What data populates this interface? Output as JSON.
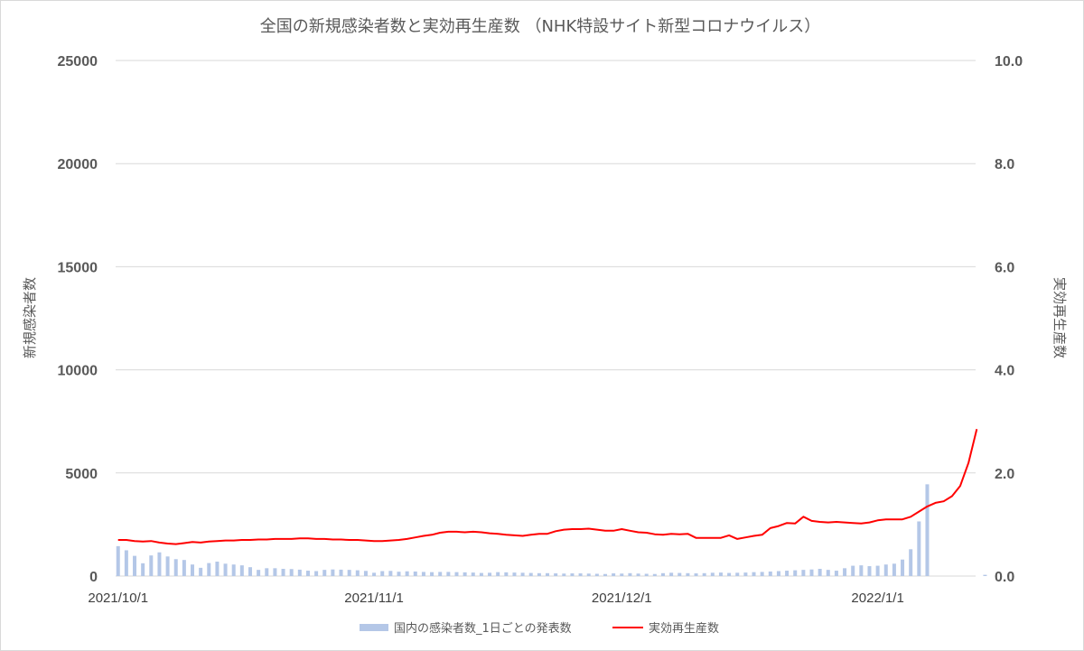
{
  "chart_data": {
    "type": "bar+line",
    "title": "全国の新規感染者数と実効再生産数 （NHK特設サイト新型コロナウイルス）",
    "ylabel_left": "新規感染者数",
    "ylabel_right": "実効再生産数",
    "ylim_left": [
      0,
      25000
    ],
    "ylim_right": [
      0.0,
      10.0
    ],
    "yticks_left": [
      "0",
      "5000",
      "10000",
      "15000",
      "20000",
      "25000"
    ],
    "yticks_right": [
      "0.0",
      "2.0",
      "4.0",
      "6.0",
      "8.0",
      "10.0"
    ],
    "xticks": [
      "2021/10/1",
      "2021/11/1",
      "2021/12/1",
      "2022/1/1"
    ],
    "grid": true,
    "legend_position": "bottom",
    "colors": {
      "bars": "#b4c7e7",
      "line": "#ff0000",
      "grid": "#d9d9d9"
    },
    "x_start": "2021/10/1",
    "x_end": "2022/1/16",
    "series": [
      {
        "name": "国内の感染者数_1日ごとの発表数",
        "kind": "bar",
        "axis": "left",
        "values": [
          1450,
          1250,
          980,
          620,
          1000,
          1150,
          950,
          820,
          780,
          560,
          400,
          630,
          700,
          600,
          560,
          520,
          430,
          300,
          380,
          380,
          350,
          340,
          310,
          260,
          240,
          300,
          320,
          310,
          300,
          280,
          250,
          160,
          240,
          250,
          210,
          230,
          220,
          200,
          190,
          200,
          200,
          190,
          180,
          170,
          150,
          160,
          190,
          180,
          170,
          160,
          150,
          140,
          140,
          130,
          120,
          130,
          130,
          120,
          110,
          100,
          130,
          120,
          140,
          120,
          110,
          100,
          140,
          160,
          150,
          140,
          130,
          140,
          160,
          170,
          150,
          160,
          170,
          190,
          200,
          220,
          240,
          260,
          280,
          300,
          320,
          350,
          300,
          260,
          380,
          500,
          520,
          480,
          500,
          560,
          600,
          800,
          1300,
          2650,
          4450,
          0,
          0,
          0,
          0,
          0,
          0,
          60,
          0
        ]
      },
      {
        "name": "実効再生産数",
        "kind": "line",
        "axis": "right",
        "values": [
          0.7,
          0.7,
          0.68,
          0.67,
          0.68,
          0.65,
          0.63,
          0.62,
          0.64,
          0.66,
          0.65,
          0.67,
          0.68,
          0.69,
          0.69,
          0.7,
          0.7,
          0.71,
          0.71,
          0.72,
          0.72,
          0.72,
          0.73,
          0.73,
          0.72,
          0.72,
          0.71,
          0.71,
          0.7,
          0.7,
          0.69,
          0.68,
          0.68,
          0.69,
          0.7,
          0.72,
          0.75,
          0.78,
          0.8,
          0.84,
          0.86,
          0.86,
          0.85,
          0.86,
          0.85,
          0.83,
          0.82,
          0.8,
          0.79,
          0.78,
          0.8,
          0.82,
          0.82,
          0.87,
          0.9,
          0.91,
          0.91,
          0.92,
          0.9,
          0.88,
          0.88,
          0.91,
          0.88,
          0.85,
          0.84,
          0.81,
          0.8,
          0.82,
          0.81,
          0.82,
          0.74,
          0.74,
          0.74,
          0.74,
          0.79,
          0.72,
          0.75,
          0.78,
          0.8,
          0.93,
          0.97,
          1.03,
          1.02,
          1.15,
          1.07,
          1.05,
          1.04,
          1.05,
          1.04,
          1.03,
          1.02,
          1.04,
          1.08,
          1.1,
          1.1,
          1.1,
          1.15,
          1.25,
          1.35,
          1.42,
          1.45,
          1.55,
          1.75,
          2.2,
          2.85
        ]
      }
    ]
  }
}
